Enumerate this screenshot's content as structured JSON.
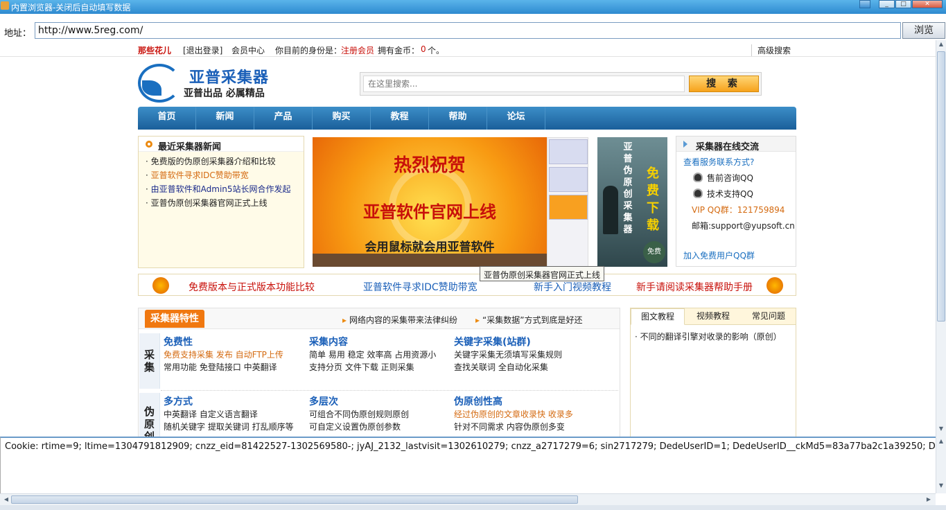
{
  "window": {
    "title": "内置浏览器-关闭后自动填写数据"
  },
  "address_bar": {
    "label": "地址：",
    "url": "http://www.5reg.com/",
    "go_label": "浏览"
  },
  "top_strip": {
    "username": "那些花儿",
    "logout": "[退出登录]",
    "member_center": "会员中心",
    "identity_label": "你目前的身份是：",
    "identity_value": "注册会员",
    "coins_label": "拥有金币：",
    "coins_value": "0",
    "coins_unit": "个。",
    "advanced_search": "高级搜索"
  },
  "logo": {
    "title": "亚普采集器",
    "slogan": "亚普出品 必属精品"
  },
  "search": {
    "placeholder": "在这里搜索...",
    "button": "搜 索"
  },
  "nav": [
    "首页",
    "新闻",
    "产品",
    "购买",
    "教程",
    "帮助",
    "论坛"
  ],
  "news": {
    "heading": "最近采集器新闻",
    "items": [
      {
        "text": "免费版的伪原创采集器介绍和比较",
        "color": "#222222"
      },
      {
        "text": "亚普软件寻求IDC赞助带宽",
        "color": "#d46a10"
      },
      {
        "text": "由亚普软件和Admin5站长网合作发起",
        "color": "#1a2a8a"
      },
      {
        "text": "亚普伪原创采集器官网正式上线",
        "color": "#222222"
      }
    ]
  },
  "banner": {
    "line1": "热烈祝贺",
    "line2": "亚普软件官网上线",
    "line3": "会用鼠标就会用亚普软件"
  },
  "promo": {
    "vertical1": "亚普伪原创采集器",
    "vertical2": "免费下载",
    "badge": "免费"
  },
  "online": {
    "heading": "采集器在线交流",
    "contact": "查看服务联系方式?",
    "presale_qq": "售前咨询QQ",
    "support_qq": "技术支持QQ",
    "vip_group": "VIP QQ群：121759894",
    "email": "邮箱:support@yupsoft.cn",
    "join_group": "加入免费用户QQ群"
  },
  "tooltip": "亚普伪原创采集器官网正式上线",
  "ticker": [
    "免费版本与正式版本功能比较",
    "亚普软件寻求IDC赞助带宽",
    "新手入门视频教程",
    "新手请阅读采集器帮助手册"
  ],
  "features": {
    "tag": "采集器特性",
    "headlines": [
      "网络内容的采集带来法律纠纷",
      "“采集数据”方式到底是好还"
    ],
    "sections": [
      {
        "side": "采集",
        "cols": [
          {
            "title": "免费性",
            "line1": "免费支持采集 发布 自动FTP上传",
            "line1_color": "#d46a10",
            "line2": "常用功能 免登陆接口 中英翻译"
          },
          {
            "title": "采集内容",
            "line1": "简单 易用 稳定 效率高 占用资源小",
            "line1_color": "#222222",
            "line2": "支持分页 文件下载 正则采集"
          },
          {
            "title": "关键字采集(站群)",
            "line1": "关键字采集无须填写采集规则",
            "line1_color": "#222222",
            "line2": "查找关联词 全自动化采集"
          }
        ]
      },
      {
        "side": "伪原创",
        "cols": [
          {
            "title": "多方式",
            "line1": "中英翻译 自定义语言翻译",
            "line1_color": "#222222",
            "line2": "随机关键字 提取关键词 打乱顺序等"
          },
          {
            "title": "多层次",
            "line1": "可组合不同伪原创规则原创",
            "line1_color": "#222222",
            "line2": "可自定义设置伪原创参数"
          },
          {
            "title": "伪原创性高",
            "line1": "经过伪原创的文章收录快 收录多",
            "line1_color": "#d46a10",
            "line2": "针对不同需求 内容伪原创多变"
          }
        ]
      }
    ]
  },
  "tutorial": {
    "tabs": [
      "图文教程",
      "视频教程",
      "常见问题"
    ],
    "items": [
      "不同的翻译引擎对收录的影响（原创）"
    ]
  },
  "cookie": {
    "text": "Cookie: rtime=9; ltime=1304791812909; cnzz_eid=81422527-1302569580-; jyAJ_2132_lastvisit=1302610279; cnzz_a2717279=6; sin2717279; DedeUserID=1; DedeUserID__ckMd5=83a77ba2c1a39250; D"
  },
  "colors": {
    "accent": "#1a5fb8",
    "orange": "#f07810",
    "red_link": "#c8100a"
  }
}
